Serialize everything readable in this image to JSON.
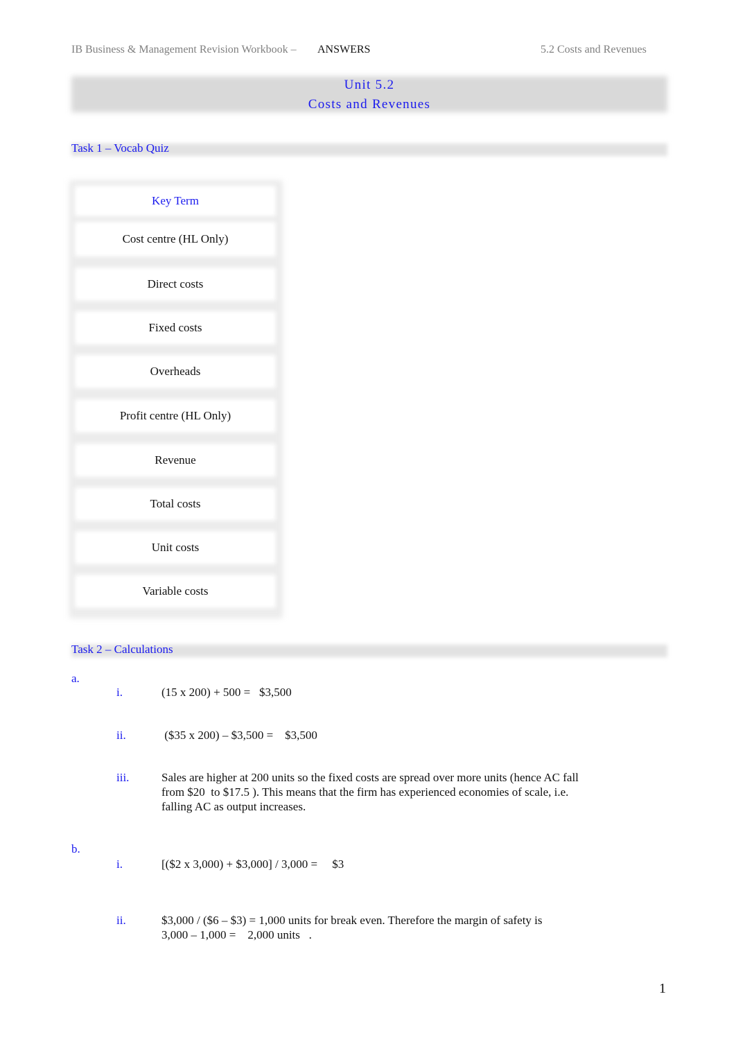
{
  "header": {
    "left": "IB Business & Management Revision Workbook –",
    "answers": "ANSWERS",
    "right": "5.2 Costs and Revenues"
  },
  "title": {
    "line1": "Unit 5.2",
    "line2": "Costs and Revenues"
  },
  "task1": {
    "heading": "Task 1 – Vocab Quiz",
    "table_header": "Key Term",
    "terms": [
      "Cost centre (HL Only)",
      "Direct costs",
      "Fixed costs",
      "Overheads",
      "Profit centre (HL Only)",
      "Revenue",
      "Total costs",
      "Unit costs",
      "Variable costs"
    ]
  },
  "task2": {
    "heading": "Task 2 – Calculations",
    "a": {
      "label": "a.",
      "items": [
        {
          "num": "i.",
          "text": "(15 x 200) + 500 =   $3,500"
        },
        {
          "num": "ii.",
          "text": " ($35 x 200) – $3,500 =    $3,500"
        },
        {
          "num": "iii.",
          "text": "Sales are higher at 200 units so the fixed costs are spread over more units (hence AC fall\nfrom $20  to $17.5 ). This means that the firm has experienced economies of scale, i.e.\nfalling AC as output increases."
        }
      ]
    },
    "b": {
      "label": "b.",
      "items": [
        {
          "num": "i.",
          "text": "[($2 x 3,000) + $3,000] / 3,000 =     $3"
        },
        {
          "num": "ii.",
          "text": "$3,000 / ($6 – $3) = 1,000 units for break even. Therefore the margin of safety is\n3,000 – 1,000 =    2,000 units   ."
        }
      ]
    }
  },
  "footer": {
    "page_number": "1"
  }
}
